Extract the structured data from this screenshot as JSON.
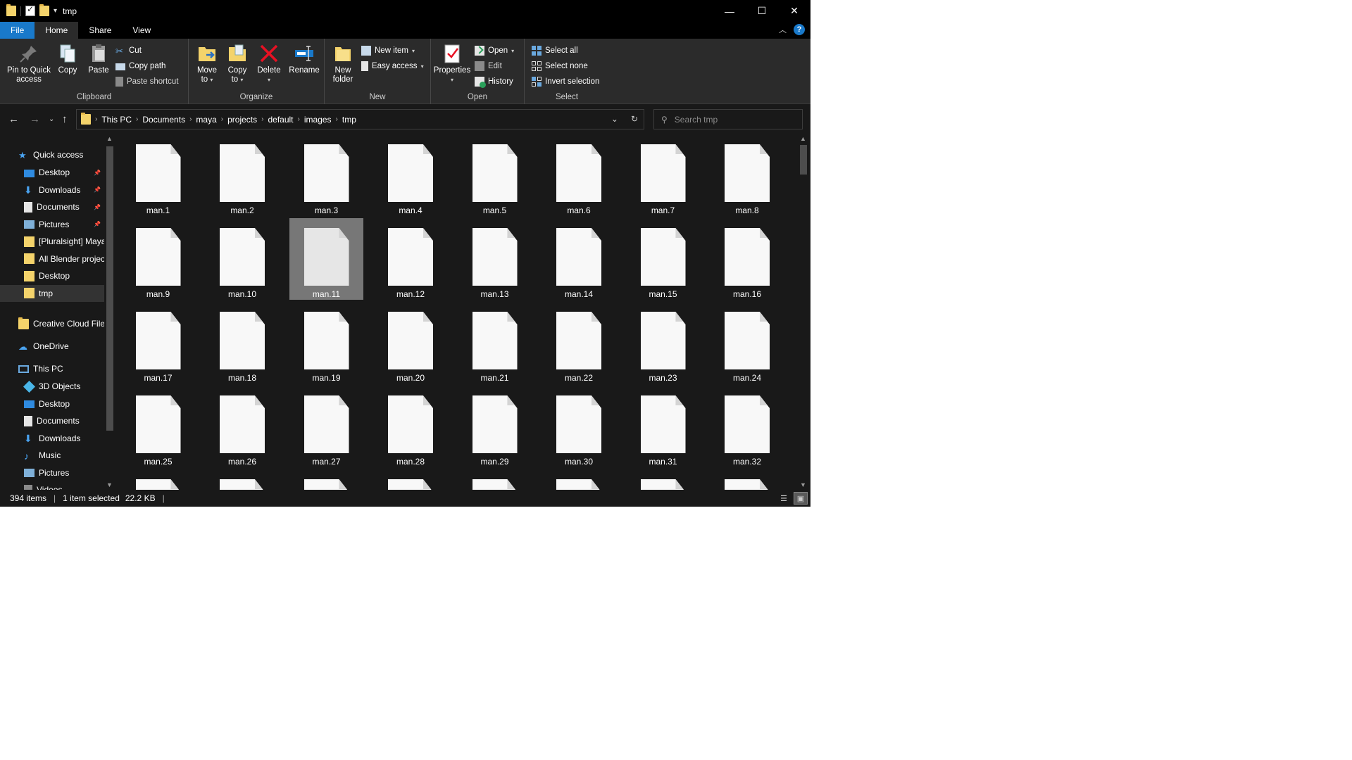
{
  "window": {
    "title": "tmp"
  },
  "window_controls": {
    "minimize": "—",
    "maximize": "☐",
    "close": "✕"
  },
  "tabs": [
    "File",
    "Home",
    "Share",
    "View"
  ],
  "ribbon": {
    "clipboard": {
      "label": "Clipboard",
      "pin": [
        "Pin to Quick",
        "access"
      ],
      "copy": "Copy",
      "paste": "Paste",
      "cut": "Cut",
      "copy_path": "Copy path",
      "paste_shortcut": "Paste shortcut"
    },
    "organize": {
      "label": "Organize",
      "move": [
        "Move",
        "to"
      ],
      "copy": [
        "Copy",
        "to"
      ],
      "delete": "Delete",
      "rename": "Rename"
    },
    "new": {
      "label": "New",
      "new_folder": [
        "New",
        "folder"
      ],
      "new_item": "New item",
      "easy_access": "Easy access"
    },
    "open": {
      "label": "Open",
      "properties": "Properties",
      "open": "Open",
      "edit": "Edit",
      "history": "History"
    },
    "select": {
      "label": "Select",
      "select_all": "Select all",
      "select_none": "Select none",
      "invert": "Invert selection"
    }
  },
  "breadcrumb": [
    "This PC",
    "Documents",
    "maya",
    "projects",
    "default",
    "images",
    "tmp"
  ],
  "search": {
    "placeholder": "Search tmp"
  },
  "nav": {
    "quick_access": "Quick access",
    "quick_items": [
      {
        "label": "Desktop",
        "icon": "desktop-icon",
        "pinned": true
      },
      {
        "label": "Downloads",
        "icon": "downloads-icon",
        "pinned": true
      },
      {
        "label": "Documents",
        "icon": "documents-icon",
        "pinned": true
      },
      {
        "label": "Pictures",
        "icon": "pictures-icon",
        "pinned": true
      },
      {
        "label": "[Pluralsight] Maya",
        "icon": "folder-icon",
        "pinned": false
      },
      {
        "label": "All Blender projec",
        "icon": "folder-icon",
        "pinned": false
      },
      {
        "label": "Desktop",
        "icon": "folder-icon",
        "pinned": false
      },
      {
        "label": "tmp",
        "icon": "folder-icon",
        "pinned": false,
        "selected": true
      }
    ],
    "creative_cloud": "Creative Cloud File",
    "onedrive": "OneDrive",
    "this_pc": "This PC",
    "pc_items": [
      {
        "label": "3D Objects",
        "icon": "3d-objects-icon"
      },
      {
        "label": "Desktop",
        "icon": "desktop-icon"
      },
      {
        "label": "Documents",
        "icon": "documents-icon"
      },
      {
        "label": "Downloads",
        "icon": "downloads-icon"
      },
      {
        "label": "Music",
        "icon": "music-icon"
      },
      {
        "label": "Pictures",
        "icon": "pictures-icon"
      },
      {
        "label": "Videos",
        "icon": "videos-icon"
      }
    ]
  },
  "files": [
    "man.1",
    "man.2",
    "man.3",
    "man.4",
    "man.5",
    "man.6",
    "man.7",
    "man.8",
    "man.9",
    "man.10",
    "man.11",
    "man.12",
    "man.13",
    "man.14",
    "man.15",
    "man.16",
    "man.17",
    "man.18",
    "man.19",
    "man.20",
    "man.21",
    "man.22",
    "man.23",
    "man.24",
    "man.25",
    "man.26",
    "man.27",
    "man.28",
    "man.29",
    "man.30",
    "man.31",
    "man.32",
    "",
    "",
    "",
    "",
    "",
    "",
    "",
    ""
  ],
  "selected_file": "man.11",
  "status": {
    "items": "394 items",
    "selected": "1 item selected",
    "size": "22.2 KB"
  },
  "colors": {
    "accent": "#1979ca",
    "folder": "#f4d36b",
    "delete_red": "#e81123",
    "background": "#191919",
    "ribbon": "#2b2b2b"
  }
}
